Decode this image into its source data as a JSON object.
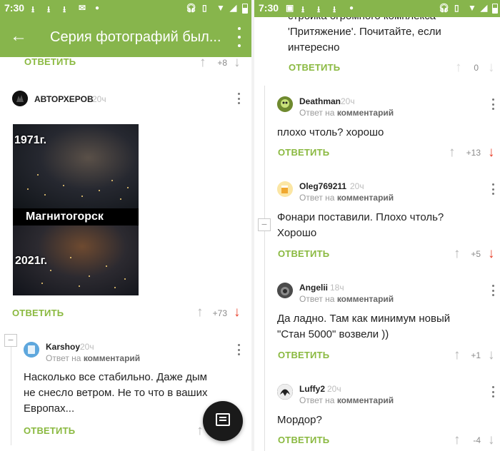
{
  "left": {
    "status": {
      "time": "7:30"
    },
    "appbar": {
      "title": "Серия фотографий был..."
    },
    "top_reply": {
      "reply": "ОТВЕТИТЬ",
      "votes": "+8"
    },
    "post": {
      "author": "АВТОРХЕРОВ",
      "time": "20ч",
      "image_labels": {
        "top": "1971г.",
        "middle": "Магнитогорск",
        "bottom": "2021г."
      },
      "reply": "ОТВЕТИТЬ",
      "votes": "+73"
    },
    "comment": {
      "author": "Karshoy",
      "time": "20ч",
      "reply_to_prefix": "Ответ на",
      "reply_to_link": "комментарий",
      "text_lines": [
        "Насколько все стабильно. Даже дым",
        "не снесло ветром. Не то что в ваших",
        "Европах..."
      ],
      "reply": "ОТВЕТИТЬ"
    }
  },
  "right": {
    "status": {
      "time": "7:30"
    },
    "top_comment": {
      "text_lines": [
        "стройка огромного комплекса",
        "'Притяжение'. Почитайте, если",
        "интересно"
      ],
      "reply": "ОТВЕТИТЬ",
      "votes": "0"
    },
    "comments": [
      {
        "author": "Deathman",
        "time": "20ч",
        "reply_to_prefix": "Ответ на",
        "reply_to_link": "комментарий",
        "text_lines": [
          "плохо чтоль? хорошо"
        ],
        "reply": "ОТВЕТИТЬ",
        "votes": "+13"
      },
      {
        "author": "Oleg769211",
        "time": "20ч",
        "reply_to_prefix": "Ответ на",
        "reply_to_link": "комментарий",
        "text_lines": [
          "Фонари поставили. Плохо чтоль?",
          "Хорошо"
        ],
        "reply": "ОТВЕТИТЬ",
        "votes": "+5"
      },
      {
        "author": "Angelii",
        "time": "18ч",
        "reply_to_prefix": "Ответ на",
        "reply_to_link": "комментарий",
        "text_lines": [
          "Да ладно. Там как минимум новый",
          "\"Стан 5000\" возвели ))"
        ],
        "reply": "ОТВЕТИТЬ",
        "votes": "+1"
      },
      {
        "author": "Luffy2",
        "time": "20ч",
        "reply_to_prefix": "Ответ на",
        "reply_to_link": "комментарий",
        "text_lines": [
          "Мордор?"
        ],
        "reply": "ОТВЕТИТЬ",
        "votes": "-4"
      }
    ]
  },
  "icons": {
    "back": "arrow-back-icon",
    "more": "more-vert-icon",
    "upvote": "arrow-up-icon",
    "downvote": "arrow-down-icon",
    "collapse": "minus-icon",
    "fab": "comment-icon"
  },
  "colors": {
    "brand": "#87b54c",
    "reply": "#8ab940",
    "downvote_active": "#e8412c",
    "fab": "#1a1a1a"
  }
}
